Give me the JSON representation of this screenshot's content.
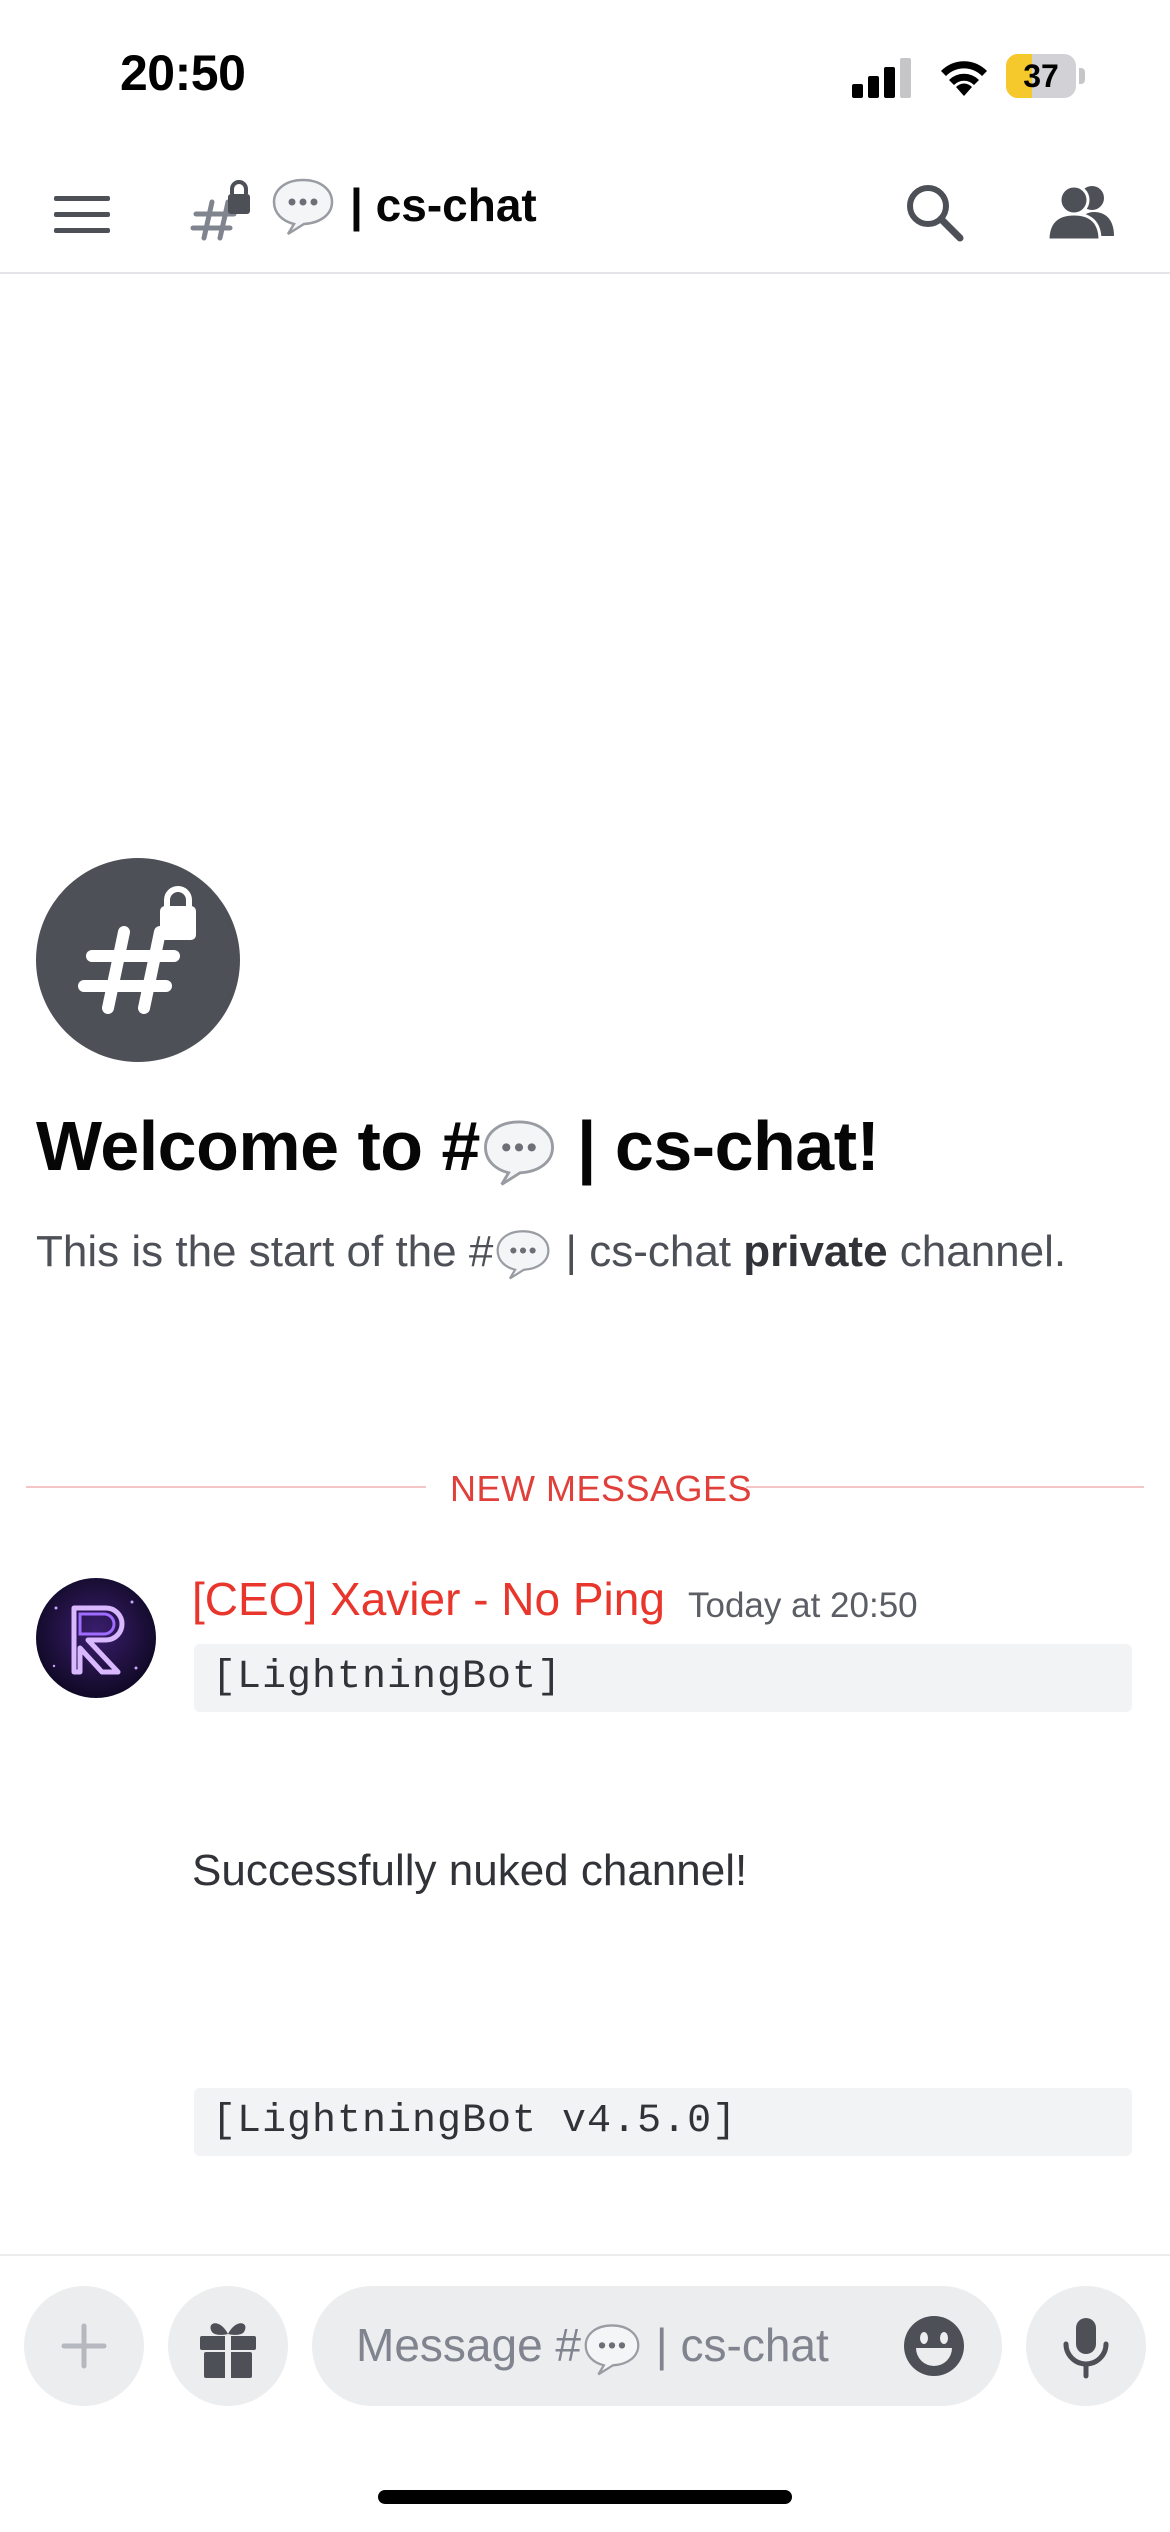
{
  "status_bar": {
    "time": "20:50",
    "battery": "37",
    "battery_level": 0.37
  },
  "header": {
    "channel_title": "| cs-chat"
  },
  "welcome": {
    "title_prefix": "Welcome to #",
    "title_suffix": " | cs-chat!",
    "sub_prefix": "This is the start of the #",
    "sub_middle": " | cs-chat ",
    "sub_bold": "private",
    "sub_suffix": " channel."
  },
  "divider": {
    "label": "NEW MESSAGES"
  },
  "message": {
    "author": "[CEO] Xavier - No Ping",
    "timestamp": "Today at 20:50",
    "code_top": "[LightningBot]",
    "text": "Successfully nuked channel!",
    "code_bottom": "[LightningBot v4.5.0]"
  },
  "composer": {
    "placeholder_prefix": "Message #",
    "placeholder_suffix": " | cs-chat"
  },
  "colors": {
    "author": "#e8362c",
    "divider": "#e03f3a",
    "battery": "#f5c92b"
  }
}
